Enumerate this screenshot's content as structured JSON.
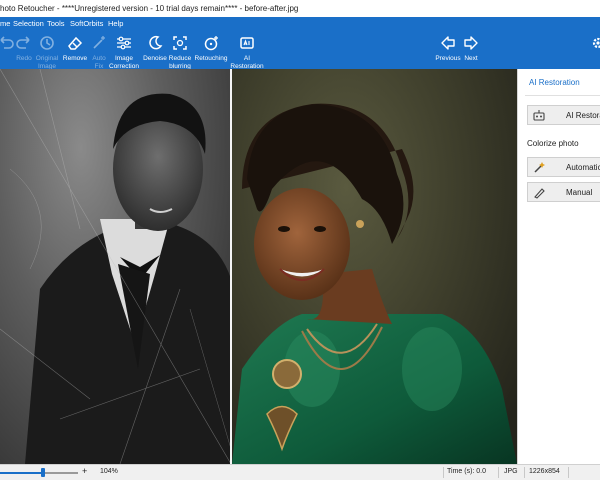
{
  "window": {
    "title": "hoto Retoucher - ****Unregistered version - 10 trial days remain**** - before-after.jpg"
  },
  "menu": [
    "me",
    "Selection",
    "Tools",
    "SoftOrbits",
    "Help"
  ],
  "toolbar": {
    "buttons": [
      {
        "icon": "undo-icon",
        "label": "",
        "enabled": false
      },
      {
        "icon": "redo-icon",
        "label": "Redo",
        "enabled": false
      },
      {
        "icon": "original-image-icon",
        "label": "Original\nImage",
        "enabled": false
      },
      {
        "icon": "eraser-icon",
        "label": "Remove",
        "enabled": true
      },
      {
        "icon": "auto-icon",
        "label": "Auto\nFix",
        "enabled": false
      },
      {
        "icon": "sliders-icon",
        "label": "Image\nCorrection",
        "enabled": true
      },
      {
        "icon": "moon-icon",
        "label": "Denoise",
        "enabled": true
      },
      {
        "icon": "focus-icon",
        "label": "Reduce\nblurring",
        "enabled": true
      },
      {
        "icon": "magic-icon",
        "label": "Retouching",
        "enabled": true
      },
      {
        "icon": "ai-icon",
        "label": "AI\nRestoration",
        "enabled": true
      }
    ],
    "previous_label": "Previous",
    "next_label": "Next",
    "accent": "#1a6fc8"
  },
  "right_panel": {
    "header": "AI Restoration",
    "ai_button_label": "AI Restoration",
    "colorize_label": "Colorize photo",
    "automatic_label": "Automatic",
    "manual_label": "Manual"
  },
  "status": {
    "zoom": "104%",
    "zoom_level": 0.55,
    "time": "Time (s): 0.0",
    "format": "JPG",
    "dimensions": "1226x854"
  }
}
